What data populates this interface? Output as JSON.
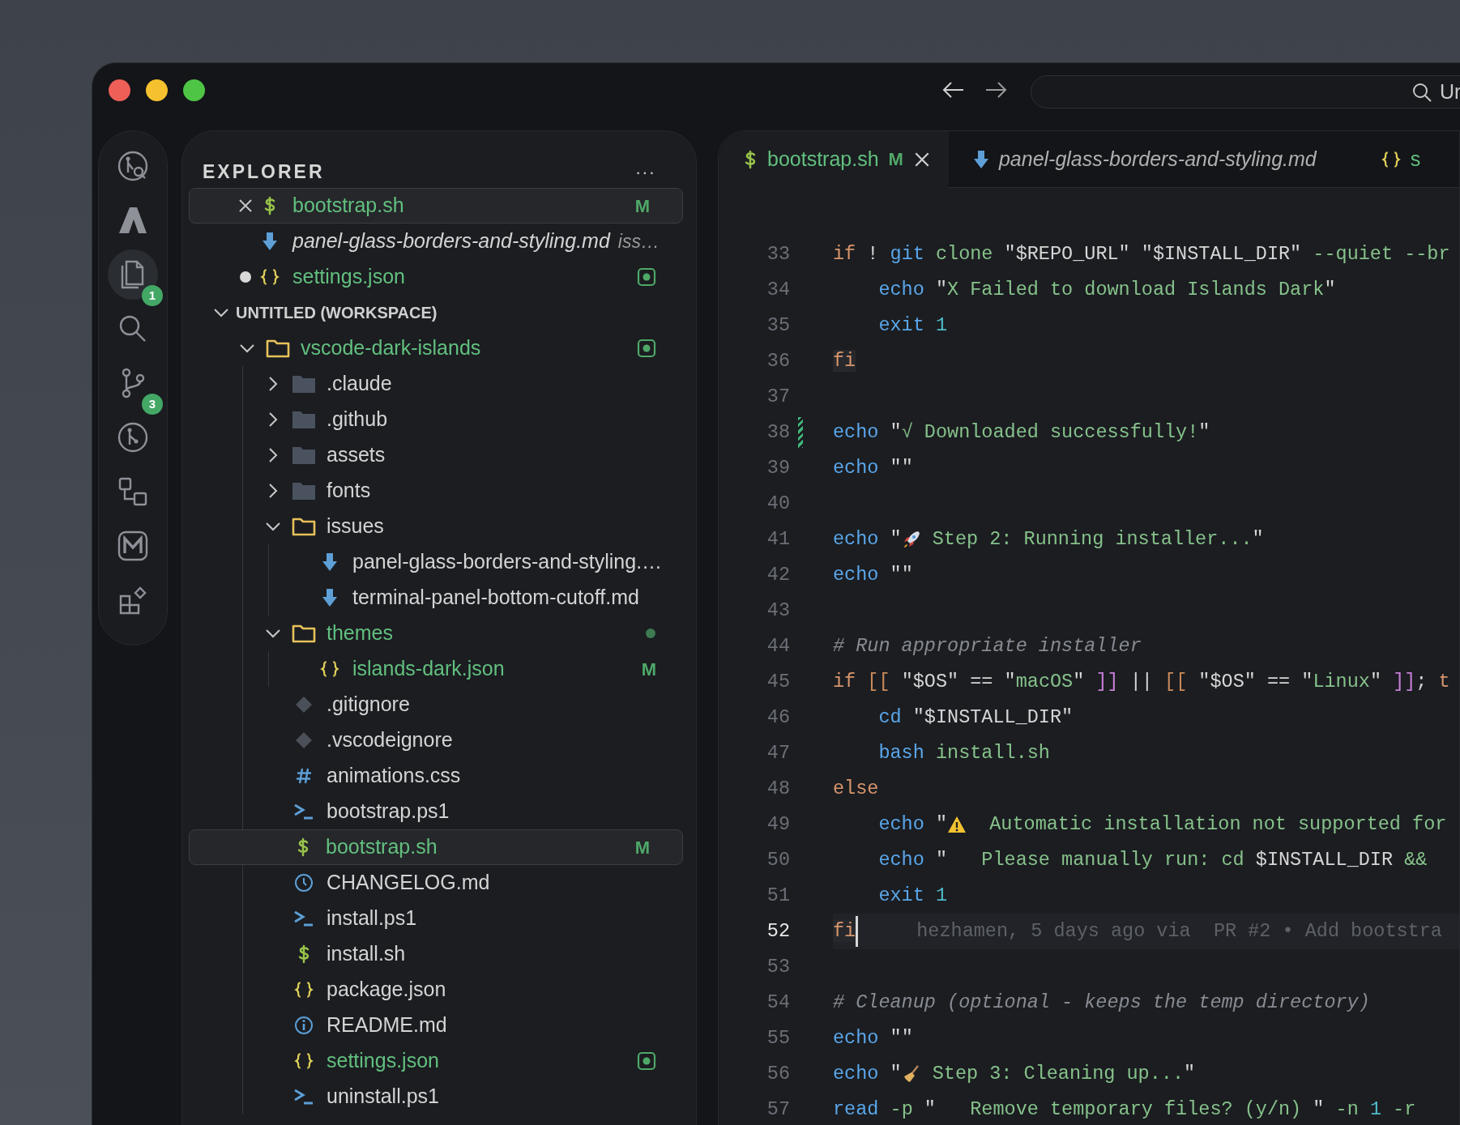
{
  "title_bar": {
    "search_text": "Ur"
  },
  "activity_bar": [
    {
      "selected": false
    },
    {
      "selected": false
    },
    {
      "selected": true,
      "badge": "1"
    },
    {
      "selected": false
    },
    {
      "selected": false,
      "badge": "3"
    },
    {
      "selected": false
    },
    {
      "selected": false
    },
    {
      "selected": false
    },
    {
      "selected": false
    }
  ],
  "explorer": {
    "title": "EXPLORER",
    "menu": "···",
    "open_editors": [
      {
        "label": "bootstrap.sh",
        "kind": "shell",
        "changed": true,
        "badge": "M",
        "selected": true,
        "dirty": false
      },
      {
        "label": "panel-glass-borders-and-styling.md",
        "kind": "markdown",
        "preview": true,
        "description": "iss…",
        "selected": false,
        "dirty": false
      },
      {
        "label": "settings.json",
        "kind": "json",
        "changed": true,
        "decoration": {
          "kind": "square"
        },
        "selected": false,
        "dirty": true
      }
    ],
    "workspace": {
      "title": "UNTITLED (WORKSPACE)",
      "expanded": true,
      "tree": [
        {
          "label": "vscode-dark-islands",
          "kind": "folder",
          "expanded": true,
          "changed": true,
          "decoration": {
            "kind": "square"
          },
          "selected": false,
          "children": [
            {
              "label": ".claude",
              "kind": "folder",
              "expanded": false,
              "selected": false
            },
            {
              "label": ".github",
              "kind": "folder",
              "expanded": false,
              "selected": false
            },
            {
              "label": "assets",
              "kind": "folder",
              "expanded": false,
              "selected": false
            },
            {
              "label": "fonts",
              "kind": "folder",
              "expanded": false,
              "selected": false
            },
            {
              "label": "issues",
              "kind": "folder",
              "expanded": true,
              "selected": false,
              "children": [
                {
                  "label": "panel-glass-borders-and-styling.…",
                  "kind": "markdown",
                  "selected": false
                },
                {
                  "label": "terminal-panel-bottom-cutoff.md",
                  "kind": "markdown",
                  "selected": false
                }
              ]
            },
            {
              "label": "themes",
              "kind": "folder",
              "expanded": true,
              "changed": true,
              "decoration": {
                "kind": "dot"
              },
              "selected": false,
              "children": [
                {
                  "label": "islands-dark.json",
                  "kind": "json",
                  "changed": true,
                  "badge": "M",
                  "selected": false
                }
              ]
            },
            {
              "label": ".gitignore",
              "kind": "git",
              "selected": false
            },
            {
              "label": ".vscodeignore",
              "kind": "git",
              "selected": false
            },
            {
              "label": "animations.css",
              "kind": "css",
              "selected": false
            },
            {
              "label": "bootstrap.ps1",
              "kind": "powershell",
              "selected": false
            },
            {
              "label": "bootstrap.sh",
              "kind": "shell",
              "changed": true,
              "badge": "M",
              "selected": true
            },
            {
              "label": "CHANGELOG.md",
              "kind": "changelog",
              "selected": false
            },
            {
              "label": "install.ps1",
              "kind": "powershell",
              "selected": false
            },
            {
              "label": "install.sh",
              "kind": "shell",
              "selected": false
            },
            {
              "label": "package.json",
              "kind": "json",
              "selected": false
            },
            {
              "label": "README.md",
              "kind": "info",
              "selected": false
            },
            {
              "label": "settings.json",
              "kind": "json",
              "changed": true,
              "decoration": {
                "kind": "square"
              },
              "selected": false
            },
            {
              "label": "uninstall.ps1",
              "kind": "powershell",
              "selected": false
            }
          ]
        }
      ]
    }
  },
  "tabs": [
    {
      "label": "bootstrap.sh",
      "kind": "shell",
      "changed": true,
      "badge": "M",
      "selected": true
    },
    {
      "label": "panel-glass-borders-and-styling.md",
      "kind": "markdown",
      "preview": true,
      "selected": false
    },
    {
      "label": "s",
      "kind": "json",
      "changed": true,
      "selected": false
    }
  ],
  "editor": {
    "lines": [
      {
        "number": "33",
        "tokens": [
          {
            "kind": "keyword",
            "text": "if"
          },
          {
            "kind": "plain",
            "text": " ! "
          },
          {
            "kind": "command",
            "text": "git"
          },
          {
            "kind": "arg",
            "text": " clone "
          },
          {
            "kind": "plain",
            "text": "\"$REPO_URL\" \"$INSTALL_DIR\""
          },
          {
            "kind": "arg",
            "text": " --quiet --br"
          }
        ]
      },
      {
        "number": "34",
        "indent": true,
        "tokens": [
          {
            "kind": "command",
            "text": "echo"
          },
          {
            "kind": "plain",
            "text": " \""
          },
          {
            "kind": "string",
            "text": "X Failed to download Islands Dark"
          },
          {
            "kind": "plain",
            "text": "\""
          }
        ]
      },
      {
        "number": "35",
        "indent": true,
        "tokens": [
          {
            "kind": "command",
            "text": "exit"
          },
          {
            "kind": "number",
            "text": " 1"
          }
        ]
      },
      {
        "number": "36",
        "tokens": [
          {
            "kind": "keyword",
            "text": "fi",
            "match": true
          }
        ]
      },
      {
        "number": "37"
      },
      {
        "number": "38",
        "added": true,
        "tokens": [
          {
            "kind": "command",
            "text": "echo"
          },
          {
            "kind": "plain",
            "text": " \""
          },
          {
            "kind": "string",
            "text": "√ Downloaded successfully!"
          },
          {
            "kind": "plain",
            "text": "\""
          }
        ]
      },
      {
        "number": "39",
        "tokens": [
          {
            "kind": "command",
            "text": "echo"
          },
          {
            "kind": "plain",
            "text": " \"\""
          }
        ]
      },
      {
        "number": "40"
      },
      {
        "number": "41",
        "tokens": [
          {
            "kind": "command",
            "text": "echo"
          },
          {
            "kind": "plain",
            "text": " \""
          },
          {
            "kind": "emoji"
          },
          {
            "kind": "string",
            "text": " Step 2: Running installer..."
          },
          {
            "kind": "plain",
            "text": "\""
          }
        ]
      },
      {
        "number": "42",
        "tokens": [
          {
            "kind": "command",
            "text": "echo"
          },
          {
            "kind": "plain",
            "text": " \"\""
          }
        ]
      },
      {
        "number": "43"
      },
      {
        "number": "44",
        "tokens": [
          {
            "kind": "comment",
            "text": "# Run appropriate installer"
          }
        ]
      },
      {
        "number": "45",
        "tokens": [
          {
            "kind": "keyword",
            "text": "if"
          },
          {
            "kind": "open_bracket",
            "text": " [["
          },
          {
            "kind": "plain",
            "text": " \"$OS\" == \""
          },
          {
            "kind": "string",
            "text": "macOS"
          },
          {
            "kind": "plain",
            "text": "\" "
          },
          {
            "kind": "close_bracket",
            "text": "]]"
          },
          {
            "kind": "plain",
            "text": " || "
          },
          {
            "kind": "open_bracket",
            "text": "[["
          },
          {
            "kind": "plain",
            "text": " \"$OS\" == \""
          },
          {
            "kind": "string",
            "text": "Linux"
          },
          {
            "kind": "plain",
            "text": "\" "
          },
          {
            "kind": "close_bracket",
            "text": "]]"
          },
          {
            "kind": "plain",
            "text": "; "
          },
          {
            "kind": "keyword",
            "text": "t"
          }
        ]
      },
      {
        "number": "46",
        "indent": true,
        "tokens": [
          {
            "kind": "command",
            "text": "cd"
          },
          {
            "kind": "plain",
            "text": " \"$INSTALL_DIR\""
          }
        ]
      },
      {
        "number": "47",
        "indent": true,
        "tokens": [
          {
            "kind": "command",
            "text": "bash"
          },
          {
            "kind": "arg",
            "text": " install.sh"
          }
        ]
      },
      {
        "number": "48",
        "tokens": [
          {
            "kind": "keyword",
            "text": "else"
          }
        ]
      },
      {
        "number": "49",
        "indent": true,
        "tokens": [
          {
            "kind": "command",
            "text": "echo"
          },
          {
            "kind": "plain",
            "text": " \""
          },
          {
            "kind": "emoji"
          },
          {
            "kind": "string",
            "text": "  Automatic installation not supported for"
          }
        ]
      },
      {
        "number": "50",
        "indent": true,
        "tokens": [
          {
            "kind": "command",
            "text": "echo"
          },
          {
            "kind": "plain",
            "text": " \""
          },
          {
            "kind": "string",
            "text": "   Please manually run: cd "
          },
          {
            "kind": "plain",
            "text": "$INSTALL_DIR"
          },
          {
            "kind": "string",
            "text": " &&"
          }
        ]
      },
      {
        "number": "51",
        "indent": true,
        "tokens": [
          {
            "kind": "command",
            "text": "exit"
          },
          {
            "kind": "number",
            "text": " 1"
          }
        ]
      },
      {
        "number": "52",
        "current": true,
        "blame": "hezhamen, 5 days ago via  PR #2 • Add bootstra",
        "tokens": [
          {
            "kind": "keyword",
            "text": "fi",
            "match": true
          }
        ]
      },
      {
        "number": "53"
      },
      {
        "number": "54",
        "tokens": [
          {
            "kind": "comment",
            "text": "# Cleanup (optional - keeps the temp directory)"
          }
        ]
      },
      {
        "number": "55",
        "tokens": [
          {
            "kind": "command",
            "text": "echo"
          },
          {
            "kind": "plain",
            "text": " \"\""
          }
        ]
      },
      {
        "number": "56",
        "tokens": [
          {
            "kind": "command",
            "text": "echo"
          },
          {
            "kind": "plain",
            "text": " \""
          },
          {
            "kind": "emoji"
          },
          {
            "kind": "string",
            "text": " Step 3: Cleaning up..."
          },
          {
            "kind": "plain",
            "text": "\""
          }
        ]
      },
      {
        "number": "57",
        "tokens": [
          {
            "kind": "command",
            "text": "read"
          },
          {
            "kind": "arg",
            "text": " -p "
          },
          {
            "kind": "plain",
            "text": "\""
          },
          {
            "kind": "string",
            "text": "   Remove temporary files? (y/n) "
          },
          {
            "kind": "plain",
            "text": "\""
          },
          {
            "kind": "arg",
            "text": " -n "
          },
          {
            "kind": "number",
            "text": "1"
          },
          {
            "kind": "arg",
            "text": " -r"
          }
        ]
      }
    ]
  }
}
